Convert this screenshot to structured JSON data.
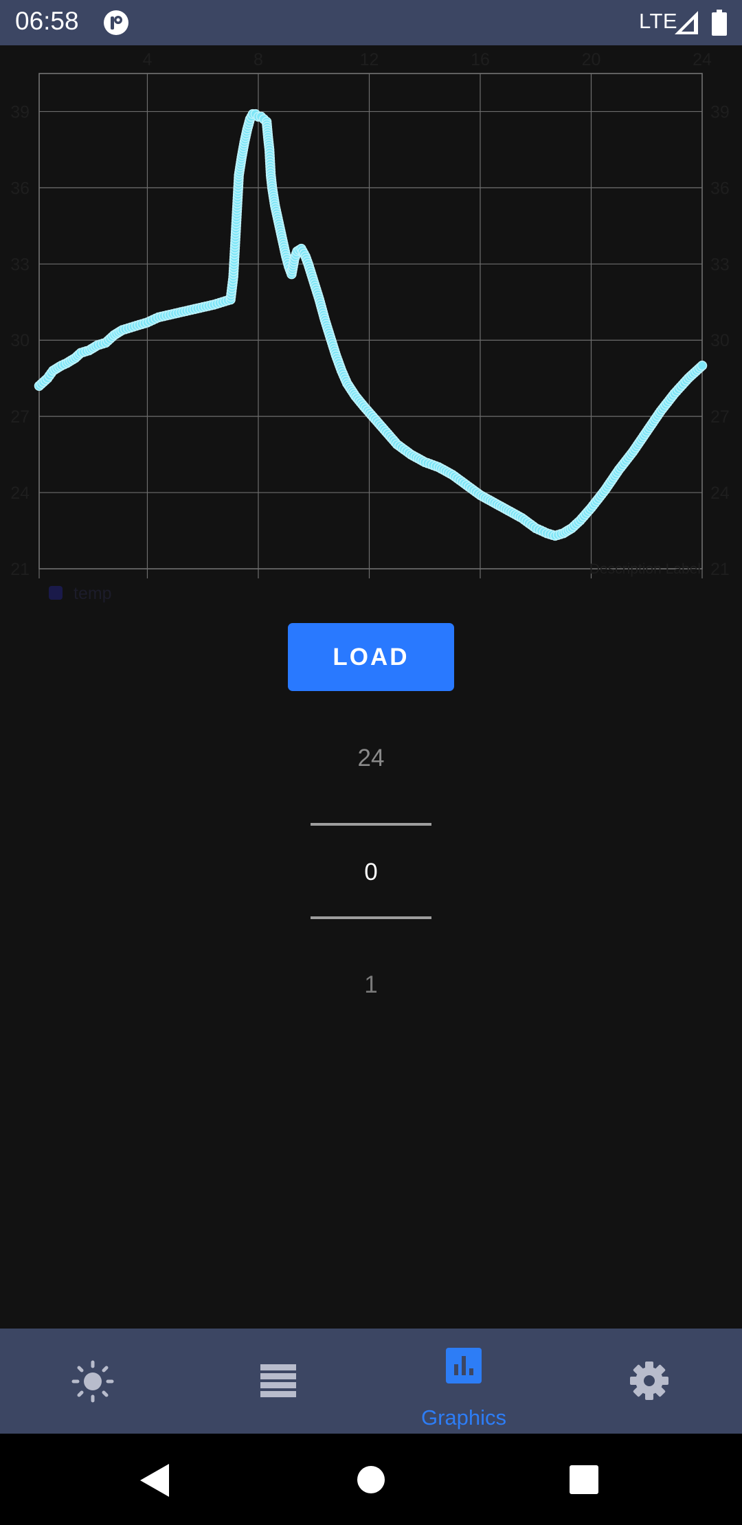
{
  "status_bar": {
    "time": "06:58",
    "network": "LTE",
    "icons": [
      "app-notification-icon",
      "signal-icon",
      "battery-icon"
    ]
  },
  "chart_data": {
    "type": "scatter",
    "title": "",
    "xlabel": "",
    "ylabel": "",
    "x_ticks": [
      4,
      8,
      12,
      16,
      20,
      24
    ],
    "y_ticks": [
      21,
      24,
      27,
      30,
      33,
      36,
      39
    ],
    "xlim": [
      0.1,
      24
    ],
    "ylim": [
      21,
      40.5
    ],
    "grid": true,
    "legend_position": "bottom-left",
    "description_label": "Description Label",
    "series": [
      {
        "name": "temp",
        "color": "#7fe6f7",
        "legend_color": "#1a1a4a",
        "points": [
          [
            0.1,
            28.2
          ],
          [
            0.4,
            28.5
          ],
          [
            0.6,
            28.8
          ],
          [
            0.9,
            29.0
          ],
          [
            1.1,
            29.1
          ],
          [
            1.4,
            29.3
          ],
          [
            1.6,
            29.5
          ],
          [
            1.9,
            29.6
          ],
          [
            2.2,
            29.8
          ],
          [
            2.5,
            29.9
          ],
          [
            2.8,
            30.2
          ],
          [
            3.1,
            30.4
          ],
          [
            3.4,
            30.5
          ],
          [
            3.7,
            30.6
          ],
          [
            4.0,
            30.7
          ],
          [
            4.4,
            30.9
          ],
          [
            4.8,
            31.0
          ],
          [
            5.2,
            31.1
          ],
          [
            5.6,
            31.2
          ],
          [
            6.0,
            31.3
          ],
          [
            6.4,
            31.4
          ],
          [
            6.7,
            31.5
          ],
          [
            7.0,
            31.6
          ],
          [
            7.1,
            32.5
          ],
          [
            7.15,
            33.5
          ],
          [
            7.2,
            34.5
          ],
          [
            7.25,
            35.5
          ],
          [
            7.3,
            36.5
          ],
          [
            7.4,
            37.2
          ],
          [
            7.5,
            37.8
          ],
          [
            7.6,
            38.3
          ],
          [
            7.7,
            38.7
          ],
          [
            7.8,
            38.9
          ],
          [
            7.9,
            38.9
          ],
          [
            8.0,
            38.8
          ],
          [
            8.1,
            38.8
          ],
          [
            8.2,
            38.7
          ],
          [
            8.3,
            38.6
          ],
          [
            8.35,
            38.0
          ],
          [
            8.4,
            37.5
          ],
          [
            8.45,
            36.5
          ],
          [
            8.5,
            36.0
          ],
          [
            8.6,
            35.3
          ],
          [
            8.7,
            34.8
          ],
          [
            8.8,
            34.3
          ],
          [
            8.9,
            33.8
          ],
          [
            9.0,
            33.3
          ],
          [
            9.1,
            32.9
          ],
          [
            9.2,
            32.6
          ],
          [
            9.3,
            33.2
          ],
          [
            9.4,
            33.5
          ],
          [
            9.55,
            33.6
          ],
          [
            9.7,
            33.3
          ],
          [
            9.8,
            33.0
          ],
          [
            10.0,
            32.3
          ],
          [
            10.2,
            31.6
          ],
          [
            10.4,
            30.8
          ],
          [
            10.6,
            30.1
          ],
          [
            10.8,
            29.4
          ],
          [
            11.0,
            28.8
          ],
          [
            11.2,
            28.3
          ],
          [
            11.5,
            27.8
          ],
          [
            11.8,
            27.4
          ],
          [
            12.2,
            26.9
          ],
          [
            12.6,
            26.4
          ],
          [
            13.0,
            25.9
          ],
          [
            13.5,
            25.5
          ],
          [
            14.0,
            25.2
          ],
          [
            14.5,
            25.0
          ],
          [
            15.0,
            24.7
          ],
          [
            15.5,
            24.3
          ],
          [
            16.0,
            23.9
          ],
          [
            16.5,
            23.6
          ],
          [
            17.0,
            23.3
          ],
          [
            17.5,
            23.0
          ],
          [
            18.0,
            22.6
          ],
          [
            18.4,
            22.4
          ],
          [
            18.7,
            22.3
          ],
          [
            19.0,
            22.4
          ],
          [
            19.3,
            22.6
          ],
          [
            19.6,
            22.9
          ],
          [
            20.0,
            23.4
          ],
          [
            20.5,
            24.1
          ],
          [
            21.0,
            24.9
          ],
          [
            21.5,
            25.6
          ],
          [
            22.0,
            26.4
          ],
          [
            22.5,
            27.2
          ],
          [
            23.0,
            27.9
          ],
          [
            23.5,
            28.5
          ],
          [
            24.0,
            29.0
          ]
        ]
      }
    ]
  },
  "load_button": {
    "label": "LOAD"
  },
  "number_picker": {
    "previous": "24",
    "current": "0",
    "next": "1"
  },
  "bottom_nav": {
    "items": [
      {
        "icon": "brightness-icon",
        "label": "",
        "active": false
      },
      {
        "icon": "list-icon",
        "label": "",
        "active": false
      },
      {
        "icon": "bar-chart-icon",
        "label": "Graphics",
        "active": true
      },
      {
        "icon": "gear-icon",
        "label": "",
        "active": false
      }
    ],
    "active_color": "#2d7df6",
    "inactive_color": "#b8bccc"
  },
  "system_nav": {
    "icons": [
      "back-icon",
      "home-icon",
      "recents-icon"
    ]
  }
}
